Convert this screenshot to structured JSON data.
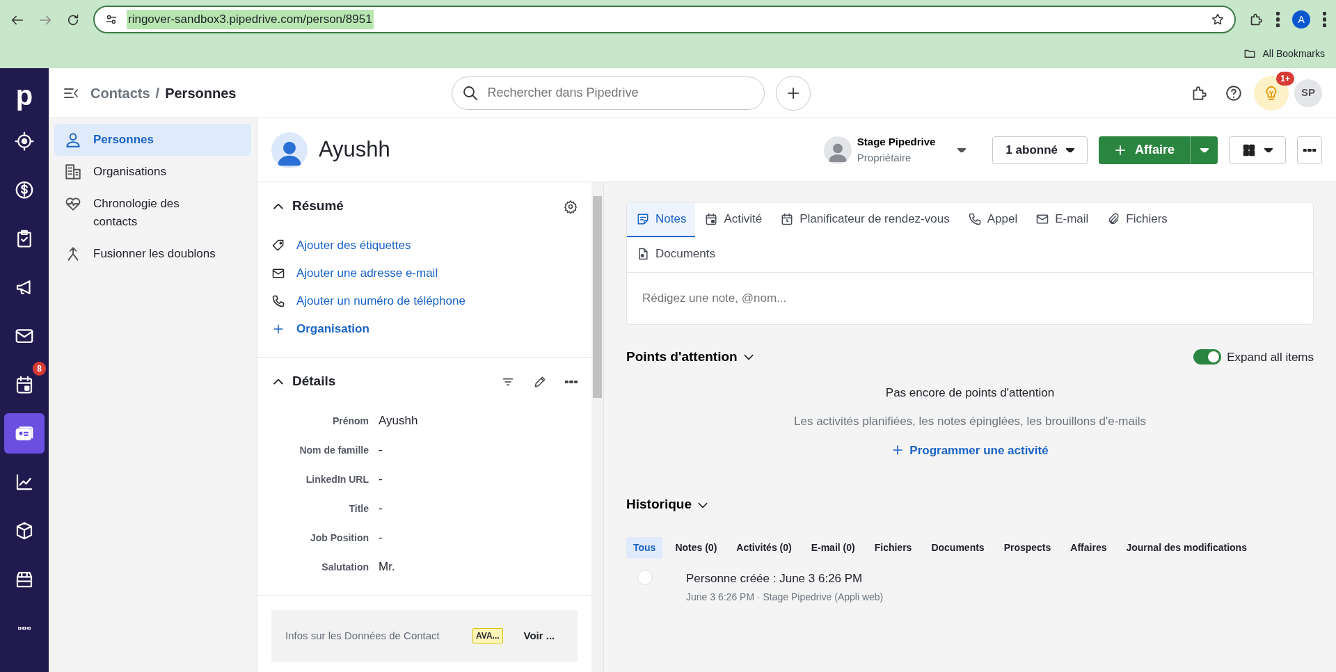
{
  "browser": {
    "url": "ringover-sandbox3.pipedrive.com/person/8951",
    "profile_initial": "A",
    "bookmarks_label": "All Bookmarks"
  },
  "nav": {
    "logo": "p",
    "items": [
      {
        "selected": false
      },
      {
        "selected": false
      },
      {
        "selected": false
      },
      {
        "selected": false
      },
      {
        "selected": false
      },
      {
        "selected": false,
        "badge": "8"
      },
      {
        "selected": true
      },
      {
        "selected": false
      },
      {
        "selected": false
      },
      {
        "selected": false
      },
      {
        "selected": false
      }
    ]
  },
  "header": {
    "breadcrumb_parent": "Contacts",
    "breadcrumb_separator": "/",
    "breadcrumb_current": "Personnes",
    "search_placeholder": "Rechercher dans Pipedrive",
    "tips_badge": "1+",
    "user_initials": "SP"
  },
  "sidebar": {
    "items": [
      {
        "label": "Personnes",
        "selected": true
      },
      {
        "label": "Organisations",
        "selected": false
      },
      {
        "label": "Chronologie des contacts",
        "selected": false
      },
      {
        "label": "Fusionner les doublons",
        "selected": false
      }
    ]
  },
  "person": {
    "name": "Ayushh",
    "owner_name": "Stage Pipedrive",
    "owner_role": "Propriétaire",
    "followers": "1 abonné",
    "deal_button": "Affaire"
  },
  "summary": {
    "title": "Résumé",
    "links": [
      {
        "kind": "field",
        "label": "Ajouter des étiquettes"
      },
      {
        "kind": "field",
        "label": "Ajouter une adresse e-mail"
      },
      {
        "kind": "field",
        "label": "Ajouter un numéro de téléphone"
      },
      {
        "kind": "entity",
        "label": "Organisation"
      }
    ]
  },
  "details": {
    "title": "Détails",
    "fields": [
      {
        "label": "Prénom",
        "value": "Ayushh"
      },
      {
        "label": "Nom de famille",
        "value": "-"
      },
      {
        "label": "LinkedIn URL",
        "value": "-"
      },
      {
        "label": "Title",
        "value": "-"
      },
      {
        "label": "Job Position",
        "value": "-"
      },
      {
        "label": "Salutation",
        "value": "Mr."
      }
    ]
  },
  "smart_card": {
    "text": "Infos sur les Données de Contact",
    "badge": "AVA...",
    "link": "Voir ..."
  },
  "composer": {
    "tabs": [
      {
        "label": "Notes",
        "selected": true
      },
      {
        "label": "Activité",
        "selected": false
      },
      {
        "label": "Planificateur de rendez-vous",
        "selected": false
      },
      {
        "label": "Appel",
        "selected": false
      },
      {
        "label": "E-mail",
        "selected": false
      },
      {
        "label": "Fichiers",
        "selected": false
      },
      {
        "label": "Documents",
        "selected": false
      }
    ],
    "placeholder": "Rédigez une note, @nom..."
  },
  "focus": {
    "title": "Points d'attention",
    "toggle": {
      "label": "Expand all items",
      "on": true
    },
    "empty_title": "Pas encore de points d'attention",
    "empty_text": "Les activités planifiées, les notes épinglées, les brouillons d'e-mails",
    "action": "Programmer une activité"
  },
  "history": {
    "title": "Historique",
    "filters": [
      {
        "label": "Tous",
        "selected": true
      },
      {
        "label": "Notes (0)",
        "selected": false
      },
      {
        "label": "Activités (0)",
        "selected": false
      },
      {
        "label": "E-mail (0)",
        "selected": false
      },
      {
        "label": "Fichiers",
        "selected": false
      },
      {
        "label": "Documents",
        "selected": false
      },
      {
        "label": "Prospects",
        "selected": false
      },
      {
        "label": "Affaires",
        "selected": false
      },
      {
        "label": "Journal des modifications",
        "selected": false
      }
    ],
    "entries": [
      {
        "title": "Personne créée : June 3 6:26 PM",
        "meta": "June 3 6:26 PM · Stage Pipedrive (Appli web)"
      }
    ]
  }
}
